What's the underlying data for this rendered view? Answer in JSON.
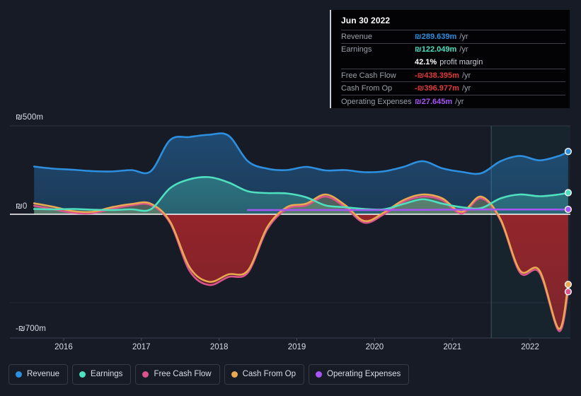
{
  "chart_data": {
    "type": "area",
    "title": "",
    "xlabel": "",
    "ylabel": "",
    "currency_symbol": "₪",
    "unit": "m",
    "period": "/yr",
    "xlim": [
      2015.6,
      2022.5
    ],
    "ylim": [
      -700,
      500
    ],
    "yticks": [
      {
        "value": 500,
        "label": "₪500m"
      },
      {
        "value": 0,
        "label": "₪0"
      },
      {
        "value": -700,
        "label": "-₪700m"
      }
    ],
    "xticks": [
      "2016",
      "2017",
      "2018",
      "2019",
      "2020",
      "2021",
      "2022"
    ],
    "grid": true,
    "legend_position": "bottom-left",
    "forecast_band_start_year": 2021.5,
    "x": [
      2015.62,
      2015.87,
      2016.12,
      2016.37,
      2016.62,
      2016.87,
      2017.12,
      2017.37,
      2017.62,
      2017.87,
      2018.12,
      2018.37,
      2018.62,
      2018.87,
      2019.12,
      2019.37,
      2019.62,
      2019.87,
      2020.12,
      2020.37,
      2020.62,
      2020.87,
      2021.12,
      2021.37,
      2021.62,
      2021.87,
      2022.12,
      2022.37,
      2022.49
    ],
    "series": [
      {
        "name": "Revenue",
        "color": "#2d8fe0",
        "values": [
          270,
          258,
          252,
          244,
          242,
          250,
          243,
          420,
          437,
          450,
          445,
          300,
          258,
          250,
          268,
          248,
          250,
          238,
          243,
          268,
          300,
          260,
          240,
          232,
          300,
          330,
          305,
          330,
          355
        ]
      },
      {
        "name": "Earnings",
        "color": "#4fe0c0",
        "values": [
          30,
          28,
          30,
          26,
          24,
          28,
          28,
          148,
          198,
          210,
          180,
          130,
          120,
          118,
          96,
          50,
          40,
          30,
          28,
          58,
          85,
          60,
          40,
          35,
          90,
          112,
          102,
          112,
          122
        ]
      },
      {
        "name": "Free Cash Flow",
        "color": "#d9538c",
        "values": [
          48,
          28,
          8,
          6,
          30,
          50,
          52,
          -50,
          -320,
          -400,
          -355,
          -330,
          -85,
          30,
          50,
          100,
          40,
          -48,
          0,
          70,
          100,
          80,
          4,
          90,
          -35,
          -330,
          -330,
          -660,
          -438
        ]
      },
      {
        "name": "Cash From Op",
        "color": "#e8a94f",
        "values": [
          62,
          42,
          18,
          14,
          40,
          58,
          60,
          -42,
          -300,
          -382,
          -340,
          -318,
          -72,
          40,
          60,
          112,
          52,
          -38,
          10,
          80,
          112,
          90,
          14,
          100,
          -28,
          -318,
          -318,
          -648,
          -397
        ]
      },
      {
        "name": "Operating Expenses",
        "color": "#a855f7",
        "values": [
          null,
          null,
          null,
          null,
          null,
          null,
          null,
          null,
          null,
          null,
          null,
          24,
          24,
          24,
          24,
          24,
          24,
          24,
          24,
          25,
          25,
          26,
          26,
          27,
          27,
          27,
          27,
          27,
          27.6
        ]
      }
    ]
  },
  "tooltip": {
    "date": "Jun 30 2022",
    "rows": [
      {
        "label": "Revenue",
        "value": "₪289.639m",
        "unit": "/yr",
        "color": "#2d8fe0"
      },
      {
        "label": "Earnings",
        "value": "₪122.049m",
        "unit": "/yr",
        "color": "#4fe0c0"
      },
      {
        "label": "",
        "value": "42.1%",
        "unit": "profit margin",
        "color": "#ffffff"
      },
      {
        "label": "Free Cash Flow",
        "value": "-₪438.395m",
        "unit": "/yr",
        "color": "#e03b3b"
      },
      {
        "label": "Cash From Op",
        "value": "-₪396.977m",
        "unit": "/yr",
        "color": "#e03b3b"
      },
      {
        "label": "Operating Expenses",
        "value": "₪27.645m",
        "unit": "/yr",
        "color": "#a855f7"
      }
    ]
  },
  "legend": {
    "items": [
      {
        "label": "Revenue",
        "color": "#2d8fe0"
      },
      {
        "label": "Earnings",
        "color": "#4fe0c0"
      },
      {
        "label": "Free Cash Flow",
        "color": "#d9538c"
      },
      {
        "label": "Cash From Op",
        "color": "#e8a94f"
      },
      {
        "label": "Operating Expenses",
        "color": "#a855f7"
      }
    ]
  },
  "axis": {
    "y_top": "₪500m",
    "y_zero": "₪0",
    "y_bottom": "-₪700m",
    "x_labels": [
      "2016",
      "2017",
      "2018",
      "2019",
      "2020",
      "2021",
      "2022"
    ]
  }
}
